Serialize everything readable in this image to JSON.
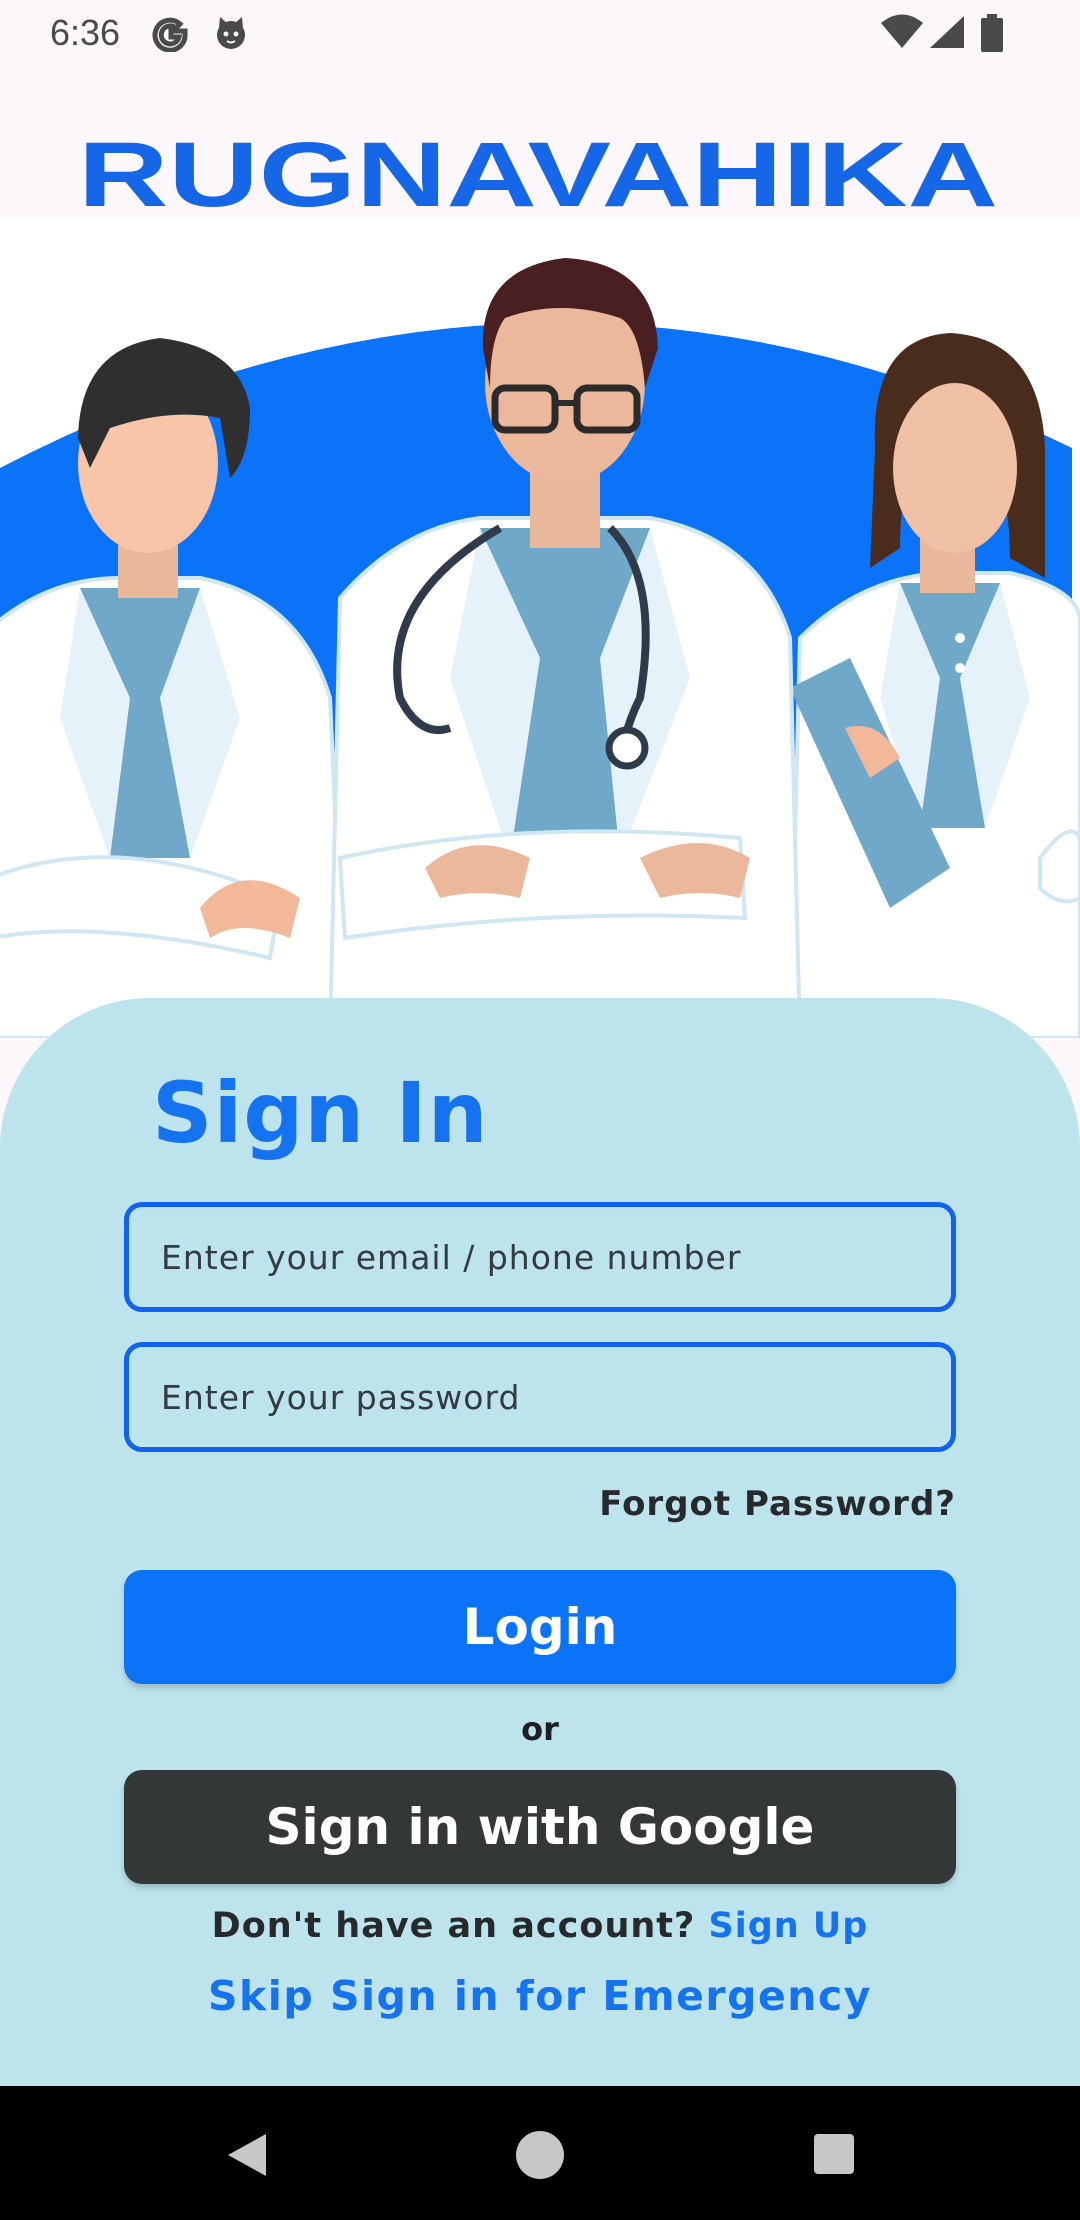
{
  "status_bar": {
    "time": "6:36",
    "icons": [
      "google-icon",
      "cat-icon",
      "wifi-icon",
      "signal-icon",
      "battery-icon"
    ]
  },
  "brand": {
    "name": "RUGNAVAHIKA",
    "color": "#1666e8"
  },
  "sign_in": {
    "title": "Sign In",
    "email_placeholder": "Enter your email / phone number",
    "password_placeholder": "Enter your password",
    "forgot_password": "Forgot Password?",
    "login_button": "Login",
    "or_text": "or",
    "google_button": "Sign in with Google",
    "no_account_text": "Don't have an account?",
    "signup_link": "Sign Up",
    "skip_link": "Skip Sign in for Emergency"
  },
  "colors": {
    "accent": "#1673f0",
    "card_bg": "#bde3ec",
    "google_button_bg": "#333738",
    "login_button_bg": "#0a73f7"
  },
  "nav_bar": {
    "icons": [
      "back-icon",
      "home-icon",
      "recent-apps-icon"
    ]
  }
}
